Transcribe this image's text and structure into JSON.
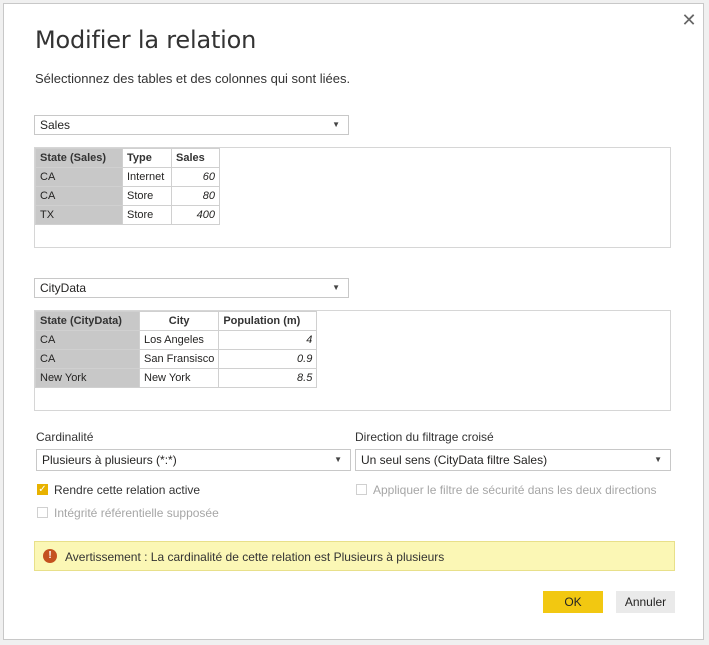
{
  "dialog": {
    "close_glyph": "✕",
    "title": "Modifier la relation",
    "subtitle": "Sélectionnez des tables et des colonnes qui sont liées."
  },
  "table1": {
    "selected": "Sales",
    "headers": [
      "State (Sales)",
      "Type",
      "Sales"
    ],
    "rows": [
      [
        "CA",
        "Internet",
        "60"
      ],
      [
        "CA",
        "Store",
        "80"
      ],
      [
        "TX",
        "Store",
        "400"
      ]
    ]
  },
  "table2": {
    "selected": "CityData",
    "headers": [
      "State (CityData)",
      "City",
      "Population (m)"
    ],
    "rows": [
      [
        "CA",
        "Los Angeles",
        "4"
      ],
      [
        "CA",
        "San Fransisco",
        "0.9"
      ],
      [
        "New York",
        "New York",
        "8.5"
      ]
    ]
  },
  "cardinality": {
    "label": "Cardinalité",
    "value": "Plusieurs à plusieurs (*:*)"
  },
  "crossfilter": {
    "label": "Direction du filtrage croisé",
    "value": "Un seul sens (CityData filtre Sales)"
  },
  "options": {
    "active": {
      "label": "Rendre cette relation active",
      "checked": true
    },
    "referential": {
      "label": "Intégrité référentielle supposée",
      "checked": false,
      "disabled": true
    },
    "security": {
      "label": "Appliquer le filtre de sécurité dans les deux directions",
      "checked": false,
      "disabled": true
    }
  },
  "warning": {
    "icon": "!",
    "text": "Avertissement : La cardinalité de cette relation est Plusieurs à plusieurs"
  },
  "buttons": {
    "ok": "OK",
    "cancel": "Annuler"
  },
  "colors": {
    "accent": "#f2c811",
    "warning_bg": "#fbf7b5",
    "warning_icon": "#c4511f",
    "selected_col": "#c8c8c8"
  }
}
